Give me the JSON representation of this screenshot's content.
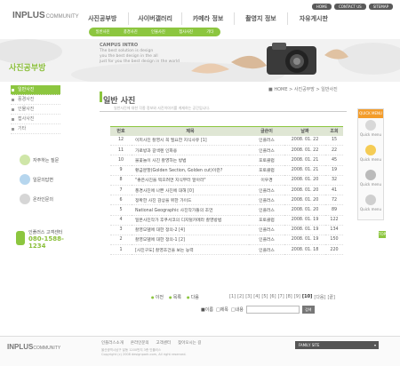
{
  "header": {
    "logo_main": "INPLUS",
    "logo_sub": "COMMUNITY",
    "top_buttons": [
      "HOME",
      "CONTACT US",
      "SITEMAP"
    ],
    "gnb": [
      "사진공부방",
      "사이버갤러리",
      "카메라 정보",
      "촬영지 정보",
      "자유게시판"
    ],
    "subnav": [
      "일반사진",
      "풍경사진",
      "인물사진",
      "접사사진",
      "기타"
    ]
  },
  "banner": {
    "campus_title": "CAMPUS INTRO",
    "campus_line1": "The best solution is design",
    "campus_line2": "you the best design in the all",
    "campus_line3": "just for you the best design in the world"
  },
  "sidebar": {
    "title": "사진공부방",
    "items": [
      "일반사진",
      "풍경사진",
      "인물사진",
      "접사사진",
      "기타"
    ],
    "links": [
      "자주하는 질문",
      "일문의답변",
      "온라인문의"
    ],
    "phone_label": "인플러스 고객센터",
    "phone_number": "080-1588-1234"
  },
  "content": {
    "breadcrumb_home": "HOME",
    "breadcrumb_mid": "사진공부방",
    "breadcrumb_cur": "일반사진",
    "page_title": "일반 사진",
    "description": "일반사진에 대한 각종 정보와 사진이야기를 게재하는 공간입니다.",
    "columns": [
      "번호",
      "제목",
      "글쓴이",
      "날짜",
      "조회"
    ],
    "rows": [
      {
        "no": "12",
        "title": "이피사진 촬영시 꼭 필요한 지식사유 [1]",
        "author": "인플러스",
        "date": "2008. 01. 22",
        "views": "15"
      },
      {
        "no": "11",
        "title": "가로방과 갈색렌 인화용",
        "author": "인플러스",
        "date": "2008. 01. 22",
        "views": "22"
      },
      {
        "no": "10",
        "title": "불꽃놀이 사진 촬영하는 방법",
        "author": "포토클럽",
        "date": "2008. 01. 21",
        "views": "45"
      },
      {
        "no": "9",
        "title": "황금분할(Golden Section, Golden cut)이란?",
        "author": "포토클럽",
        "date": "2008. 01. 21",
        "views": "19"
      },
      {
        "no": "8",
        "title": "\"좋은사진을 찍으려면 지식부터 알아라\"",
        "author": "이우경",
        "date": "2008. 01. 20",
        "views": "32"
      },
      {
        "no": "7",
        "title": "풍경사진에 나쁜 사진에 대해 [0]",
        "author": "인플러스",
        "date": "2008. 01. 20",
        "views": "41"
      },
      {
        "no": "6",
        "title": "정확한 사진 감상을 위한 가이드",
        "author": "인플러스",
        "date": "2008. 01. 20",
        "views": "72"
      },
      {
        "no": "5",
        "title": "National Geographic 사진작가들의 조언",
        "author": "인플러스",
        "date": "2008. 01. 20",
        "views": "89"
      },
      {
        "no": "4",
        "title": "일본사진작가 후쿠서코의 디지털카메라 촬영방법",
        "author": "포토클럽",
        "date": "2008. 01. 19",
        "views": "122"
      },
      {
        "no": "3",
        "title": "촬영모델에 대한 정의-2 [4]",
        "author": "인플러스",
        "date": "2008. 01. 19",
        "views": "134"
      },
      {
        "no": "2",
        "title": "촬영모델에 대한 정의-1 [2]",
        "author": "인플러스",
        "date": "2008. 01. 19",
        "views": "150"
      },
      {
        "no": "1",
        "title": "[사진구도] 촬영조건을 보는 능력",
        "author": "인플러스",
        "date": "2008. 01. 18",
        "views": "220"
      }
    ],
    "board_buttons": [
      "이전",
      "목록",
      "다음"
    ],
    "pages": [
      "[1]",
      "[2]",
      "[3]",
      "[4]",
      "[5]",
      "[6]",
      "[7]",
      "[8]",
      "[9]",
      "[10]",
      "[다음]",
      "[끝]"
    ],
    "current_page": "[10]",
    "search_opt1": "이름",
    "search_opt2": "제목",
    "search_opt3": "내용",
    "search_btn": "검색"
  },
  "quick": {
    "title": "QUICK MENU",
    "items": [
      "Quick menu",
      "Quick menu",
      "Quick menu",
      "Quick menu"
    ],
    "top": "TOP"
  },
  "footer": {
    "logo_main": "INPLUS",
    "logo_sub": "COMMUNITY",
    "links": [
      "인플러스소개",
      "온라인문의",
      "고객센터",
      "찾아오시는 길"
    ],
    "address": "울산광역시남구 달동 1200번지 3층 인플러스",
    "copyright": "Copyright (c) 2008 designpark.com, All right reserved.",
    "family_site": "FAMILY SITE"
  },
  "colors": {
    "accent": "#8cc63f",
    "quick": "#f39c2a"
  }
}
